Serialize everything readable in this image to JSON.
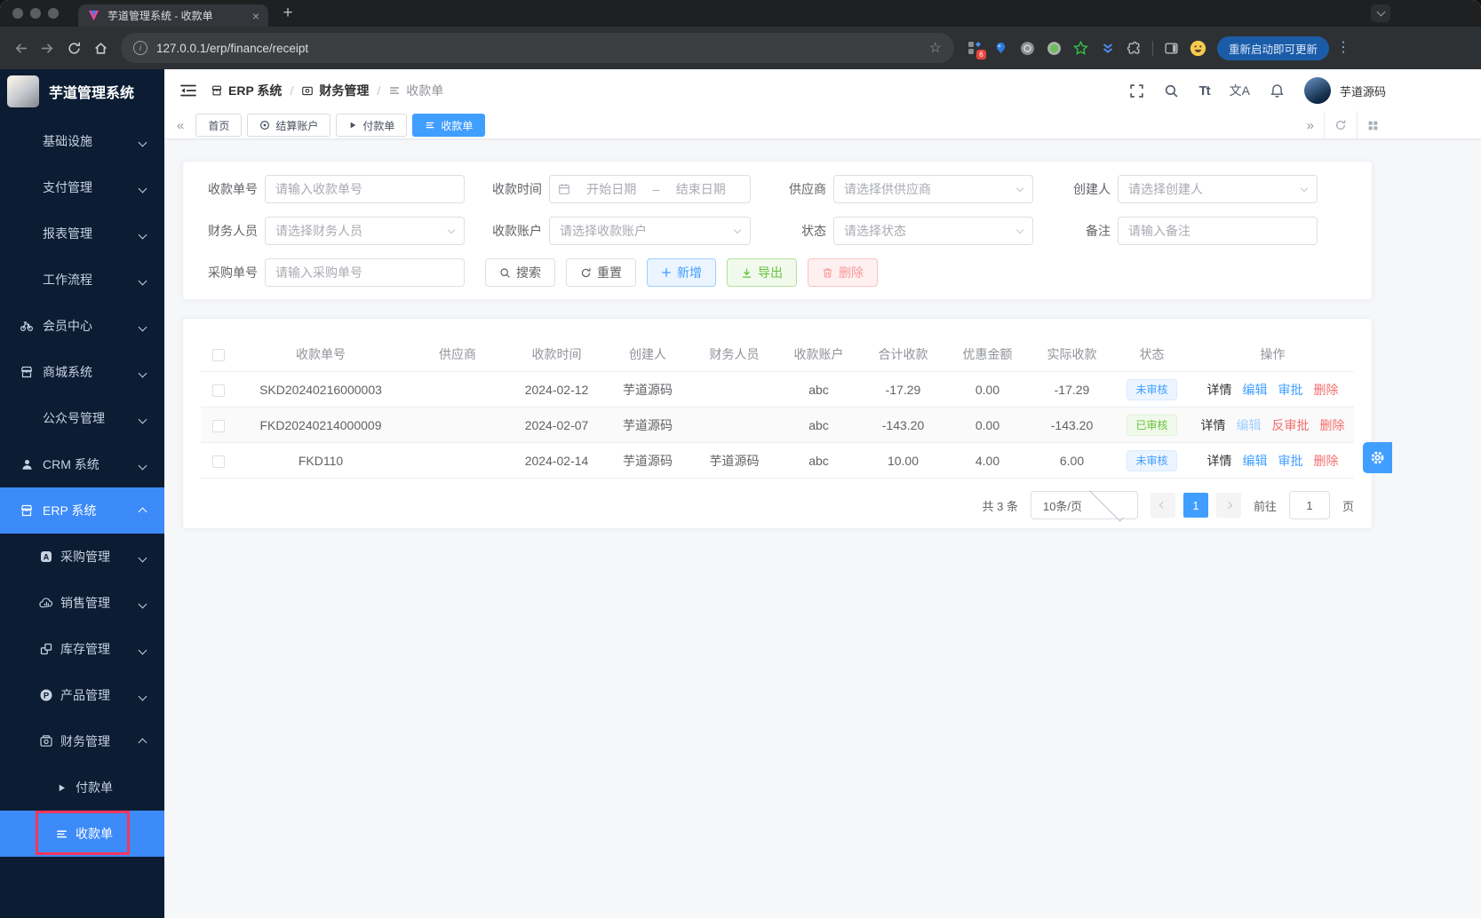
{
  "browser": {
    "tab_title": "芋道管理系统 - 收款单",
    "url": "127.0.0.1/erp/finance/receipt",
    "update_button_label": "重新启动即可更新",
    "extension_badge_count": "6"
  },
  "icons": {
    "close": "×",
    "new_tab": "+",
    "star": "☆",
    "info": "i",
    "kebab": "⋮",
    "collapse_left": "«",
    "expand_right": "»",
    "font_size": "Tt",
    "translate": "文A",
    "breadcrumb_separator": "/"
  },
  "sidebar": {
    "logo_title": "芋道管理系统",
    "items": [
      {
        "label": "基础设施"
      },
      {
        "label": "支付管理"
      },
      {
        "label": "报表管理"
      },
      {
        "label": "工作流程"
      },
      {
        "label": "会员中心"
      },
      {
        "label": "商城系统"
      },
      {
        "label": "公众号管理"
      },
      {
        "label": "CRM 系统"
      },
      {
        "label": "ERP 系统"
      },
      {
        "label": "采购管理"
      },
      {
        "label": "销售管理"
      },
      {
        "label": "库存管理"
      },
      {
        "label": "产品管理"
      },
      {
        "label": "财务管理"
      },
      {
        "label": "付款单"
      },
      {
        "label": "收款单"
      }
    ]
  },
  "header": {
    "breadcrumb": [
      {
        "label": "ERP 系统"
      },
      {
        "label": "财务管理"
      },
      {
        "label": "收款单"
      }
    ],
    "username": "芋道源码"
  },
  "tabbar": {
    "tabs": [
      {
        "label": "首页"
      },
      {
        "label": "结算账户"
      },
      {
        "label": "付款单"
      },
      {
        "label": "收款单"
      }
    ]
  },
  "filters": {
    "receipt_no": {
      "label": "收款单号",
      "placeholder": "请输入收款单号"
    },
    "receipt_time": {
      "label": "收款时间",
      "start_placeholder": "开始日期",
      "separator": "–",
      "end_placeholder": "结束日期"
    },
    "supplier": {
      "label": "供应商",
      "placeholder": "请选择供供应商"
    },
    "creator": {
      "label": "创建人",
      "placeholder": "请选择创建人"
    },
    "finance_staff": {
      "label": "财务人员",
      "placeholder": "请选择财务人员"
    },
    "receipt_account": {
      "label": "收款账户",
      "placeholder": "请选择收款账户"
    },
    "status": {
      "label": "状态",
      "placeholder": "请选择状态"
    },
    "remark": {
      "label": "备注",
      "placeholder": "请输入备注"
    },
    "purchase_no": {
      "label": "采购单号",
      "placeholder": "请输入采购单号"
    },
    "buttons": {
      "search": "搜索",
      "reset": "重置",
      "add": "新增",
      "export": "导出",
      "delete": "删除"
    }
  },
  "table": {
    "columns": [
      "收款单号",
      "供应商",
      "收款时间",
      "创建人",
      "财务人员",
      "收款账户",
      "合计收款",
      "优惠金额",
      "实际收款",
      "状态",
      "操作"
    ],
    "rows": [
      {
        "receipt_no": "SKD20240216000003",
        "supplier": "",
        "receipt_time": "2024-02-12",
        "creator": "芋道源码",
        "finance_staff": "",
        "account": "abc",
        "total": "-17.29",
        "discount": "0.00",
        "actual": "-17.29",
        "status": "未审核",
        "actions": {
          "detail": "详情",
          "edit": "编辑",
          "approve": "审批",
          "delete": "删除"
        }
      },
      {
        "receipt_no": "FKD20240214000009",
        "supplier": "",
        "receipt_time": "2024-02-07",
        "creator": "芋道源码",
        "finance_staff": "",
        "account": "abc",
        "total": "-143.20",
        "discount": "0.00",
        "actual": "-143.20",
        "status": "已审核",
        "actions": {
          "detail": "详情",
          "edit": "编辑",
          "approve": "反审批",
          "delete": "删除"
        }
      },
      {
        "receipt_no": "FKD110",
        "supplier": "",
        "receipt_time": "2024-02-14",
        "creator": "芋道源码",
        "finance_staff": "芋道源码",
        "account": "abc",
        "total": "10.00",
        "discount": "4.00",
        "actual": "6.00",
        "status": "未审核",
        "actions": {
          "detail": "详情",
          "edit": "编辑",
          "approve": "审批",
          "delete": "删除"
        }
      }
    ]
  },
  "pagination": {
    "total_text": "共 3 条",
    "page_size": "10条/页",
    "current_page": "1",
    "goto_label": "前往",
    "goto_value": "1",
    "page_unit": "页"
  },
  "colors": {
    "accent_blue": "#409eff",
    "active_menu_blue": "#3d8bf8",
    "success_green": "#67c23a",
    "danger_red": "#f56c6c",
    "sidebar_bg": "#0b1c33",
    "highlight_box_red": "#f5365c"
  }
}
